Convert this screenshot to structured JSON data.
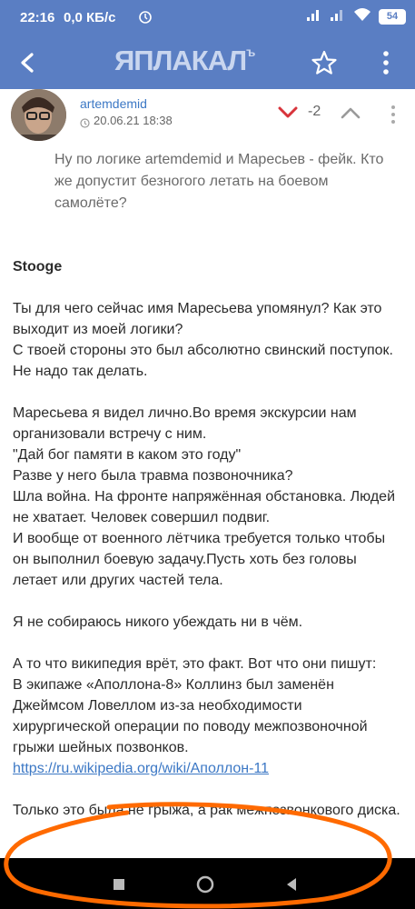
{
  "status_bar": {
    "time": "22:16",
    "network_speed": "0,0 КБ/с",
    "battery": "54"
  },
  "app_bar": {
    "logo": "ЯПЛАКАЛ",
    "logo_superscript": "ъ"
  },
  "comment": {
    "username": "artemdemid",
    "datetime": "20.06.21 18:38",
    "score": "-2",
    "quote": "Ну по логике artemdemid и Маресьев - фейк. Кто же допустит безногого летать на боевом самолёте?",
    "addressee": "Stooge",
    "paragraphs": [
      "Ты для чего сейчас имя Маресьева упомянул? Как это выходит из моей логики?\nС твоей стороны это был абсолютно свинский поступок. Не надо так делать.",
      "Маресьева я видел лично.Во время экскурсии нам организовали встречу с ним.\n\"Дай бог памяти в каком это году\"\nРазве у него была травма позвоночника?\nШла война. На фронте напряжённая обстановка. Людей не хватает. Человек совершил подвиг.\nИ вообще от военного лётчика требуется только чтобы он выполнил боевую задачу.Пусть хоть без головы летает или других частей тела.",
      "Я не собираюсь никого убеждать ни в чём.",
      "А то что википедия врёт, это факт. Вот что они пишут:\nВ экипаже «Аполлона-8» Коллинз был заменён Джеймсом Ловеллом из-за необходимости хирургической операции по поводу межпозвоночной грыжи шейных позвонков."
    ],
    "link": "https://ru.wikipedia.org/wiki/Аполлон-11",
    "last_paragraph": "Только это была не грыжа, а рак межпозвонкового диска."
  },
  "colors": {
    "header": "#5a7ec3",
    "link": "#3c78c5",
    "annotation": "#ff6a00"
  }
}
